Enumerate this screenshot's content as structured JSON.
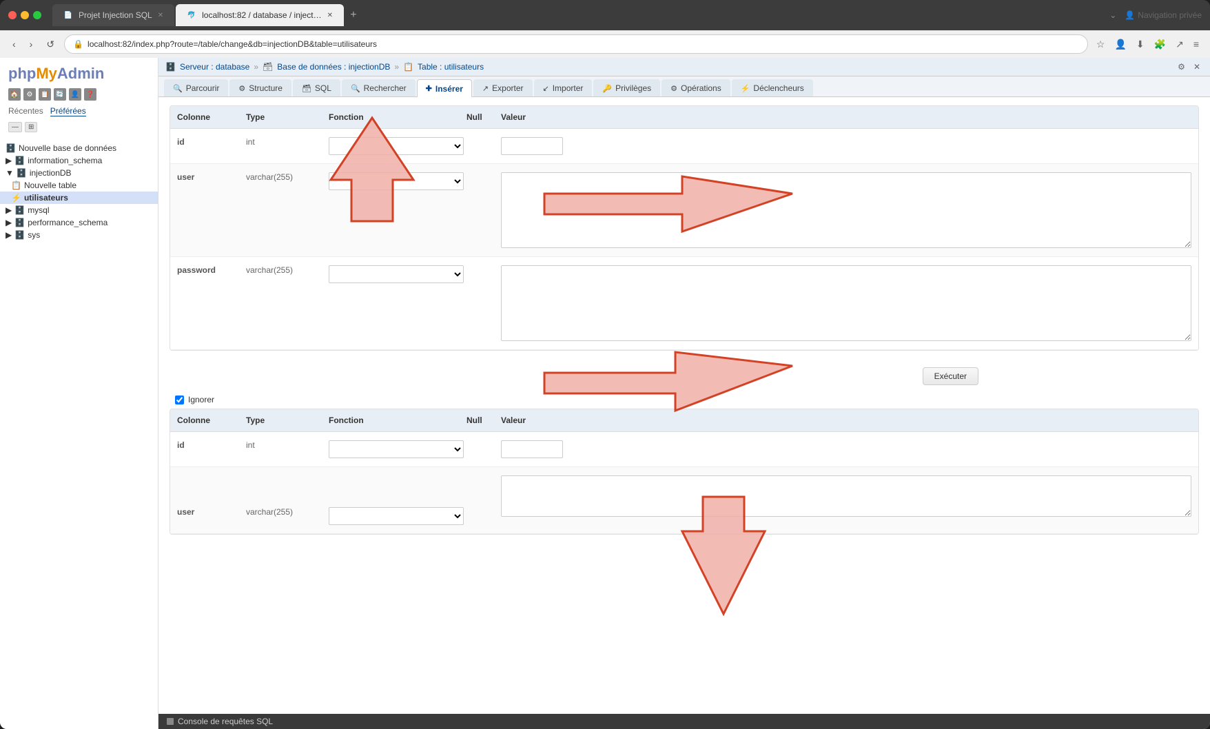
{
  "browser": {
    "tabs": [
      {
        "id": "tab1",
        "title": "Projet Injection SQL",
        "active": false,
        "favicon": "📄"
      },
      {
        "id": "tab2",
        "title": "localhost:82 / database / inject…",
        "active": true,
        "favicon": "🐬"
      }
    ],
    "new_tab_label": "+",
    "address": "localhost:82/index.php?route=/table/change&db=injectionDB&table=utilisateurs",
    "nav_back": "‹",
    "nav_forward": "›",
    "nav_reload": "↺",
    "private_mode": "Navigation privée"
  },
  "sidebar": {
    "logo": {
      "php": "php",
      "my": "My",
      "admin": "Admin"
    },
    "nav_tabs": [
      {
        "label": "Récentes",
        "active": false
      },
      {
        "label": "Préférées",
        "active": false
      }
    ],
    "expand_buttons": [
      "—",
      "⊞"
    ],
    "tree": [
      {
        "label": "Nouvelle base de données",
        "indent": 0,
        "icon": "🗄️",
        "toggle": ""
      },
      {
        "label": "information_schema",
        "indent": 0,
        "icon": "🗄️",
        "toggle": "▶"
      },
      {
        "label": "injectionDB",
        "indent": 0,
        "icon": "🗄️",
        "toggle": "▼",
        "expanded": true
      },
      {
        "label": "Nouvelle table",
        "indent": 1,
        "icon": "📋",
        "toggle": ""
      },
      {
        "label": "utilisateurs",
        "indent": 1,
        "icon": "⚡",
        "toggle": "",
        "selected": true
      },
      {
        "label": "mysql",
        "indent": 0,
        "icon": "🗄️",
        "toggle": "▶"
      },
      {
        "label": "performance_schema",
        "indent": 0,
        "icon": "🗄️",
        "toggle": "▶"
      },
      {
        "label": "sys",
        "indent": 0,
        "icon": "🗄️",
        "toggle": "▶"
      }
    ]
  },
  "breadcrumb": {
    "items": [
      {
        "label": "Serveur : database"
      },
      {
        "sep": "»"
      },
      {
        "label": "Base de données : injectionDB"
      },
      {
        "sep": "»"
      },
      {
        "label": "Table : utilisateurs"
      }
    ]
  },
  "tabs": [
    {
      "id": "parcourir",
      "label": "Parcourir",
      "icon": "🔍",
      "active": false
    },
    {
      "id": "structure",
      "label": "Structure",
      "icon": "⚙",
      "active": false
    },
    {
      "id": "sql",
      "label": "SQL",
      "icon": "🗃",
      "active": false
    },
    {
      "id": "rechercher",
      "label": "Rechercher",
      "icon": "🔍",
      "active": false
    },
    {
      "id": "inserer",
      "label": "Insérer",
      "icon": "✚",
      "active": true
    },
    {
      "id": "exporter",
      "label": "Exporter",
      "icon": "↗",
      "active": false
    },
    {
      "id": "importer",
      "label": "Importer",
      "icon": "↙",
      "active": false
    },
    {
      "id": "privileges",
      "label": "Privilèges",
      "icon": "🔑",
      "active": false
    },
    {
      "id": "operations",
      "label": "Opérations",
      "icon": "⚙",
      "active": false
    },
    {
      "id": "declencheurs",
      "label": "Déclencheurs",
      "icon": "⚡",
      "active": false
    }
  ],
  "form": {
    "section1": {
      "headers": [
        "Colonne",
        "Type",
        "Fonction",
        "Null",
        "Valeur"
      ],
      "rows": [
        {
          "column": "id",
          "type": "int",
          "function": "",
          "null_checked": false,
          "value": ""
        },
        {
          "column": "user",
          "type": "varchar(255)",
          "function": "",
          "null_checked": false,
          "value": ""
        },
        {
          "column": "password",
          "type": "varchar(255)",
          "function": "",
          "null_checked": false,
          "value": ""
        }
      ]
    },
    "section2": {
      "headers": [
        "Colonne",
        "Type",
        "Fonction",
        "Null",
        "Valeur"
      ],
      "rows": [
        {
          "column": "id",
          "type": "int",
          "function": "",
          "null_checked": false,
          "value": ""
        },
        {
          "column": "user",
          "type": "varchar(255)",
          "function": "",
          "null_checked": false,
          "value": ""
        }
      ]
    },
    "execute_button": "Exécuter",
    "ignore_label": "Ignorer"
  },
  "sql_console": {
    "label": "Console de requêtes SQL"
  },
  "colors": {
    "arrow_fill": "#e8a8a0",
    "arrow_border": "#cc2200",
    "accent_blue": "#00478f",
    "tab_active": "#3a7dbf"
  }
}
